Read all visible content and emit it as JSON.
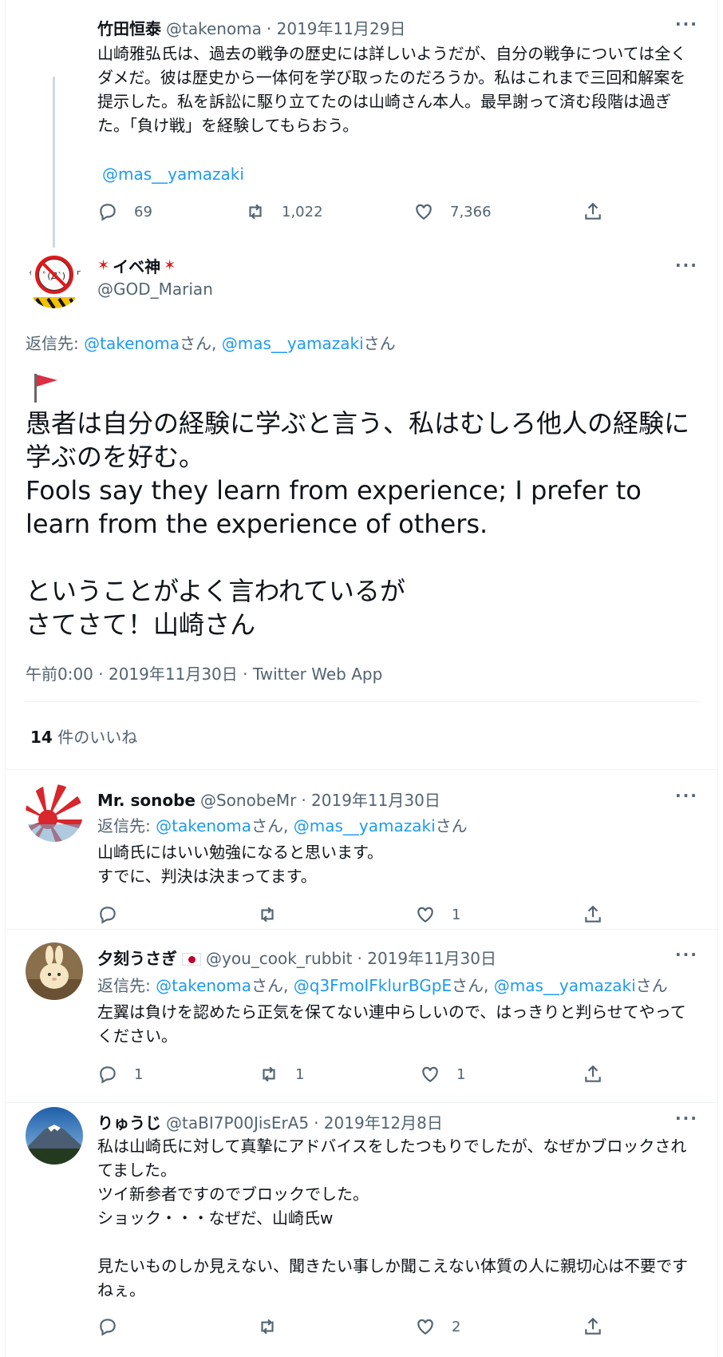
{
  "parent_tweet": {
    "name": "竹田恒泰",
    "handle": "@takenoma",
    "date": "· 2019年11月29日",
    "text": "山崎雅弘氏は、過去の戦争の歴史には詳しいようだが、自分の戦争については全くダメだ。彼は歴史から一体何を学び取ったのだろうか。私はこれまで三回和解案を提示した。私を訴訟に駆り立てたのは山崎さん本人。最早謝って済む段階は過ぎた。「負け戦」を経験してもらおう。",
    "mention": "@mas__yamazaki",
    "replies": "69",
    "retweets": "1,022",
    "likes": "7,366"
  },
  "main_tweet": {
    "name": "イベ神",
    "handle": "@GOD_Marian",
    "reply_label": "返信先: ",
    "reply_to_1": "@takenoma",
    "san": "さん",
    "sep": ", ",
    "reply_to_2": "@mas__yamazaki",
    "text": "愚者は自分の経験に学ぶと言う、私はむしろ他人の経験に学ぶのを好む。\nFools say they learn from experience; I prefer to learn from the experience of others.\n\nということがよく言われているが\nさてさて！山崎さん",
    "timestamp": "午前0:00 · 2019年11月30日 · Twitter Web App",
    "likes_count": "14",
    "likes_label": "件のいいね"
  },
  "replies": [
    {
      "name": "Mr. sonobe",
      "handle": "@SonobeMr",
      "date": "· 2019年11月30日",
      "reply_label": "返信先: ",
      "reply_to": [
        "@takenoma",
        "@mas__yamazaki"
      ],
      "san": "さん",
      "text": "山崎氏にはいい勉強になると思います。\nすでに、判決は決まってます。",
      "replies": "",
      "retweets": "",
      "likes": "1"
    },
    {
      "name": "夕刻うさぎ",
      "handle": "@you_cook_rubbit",
      "date": "· 2019年11月30日",
      "reply_label": "返信先: ",
      "reply_to": [
        "@takenoma",
        "@q3FmoIFklurBGpE",
        "@mas__yamazaki"
      ],
      "san": "さん",
      "text": "左翼は負けを認めたら正気を保てない連中らしいので、はっきりと判らせてやってください。",
      "replies": "1",
      "retweets": "1",
      "likes": "1"
    },
    {
      "name": "りゅうじ",
      "handle": "@taBI7P00JisErA5",
      "date": "· 2019年12月8日",
      "text": "私は山崎氏に対して真摯にアドバイスをしたつもりでしたが、なぜかブロックされてました。\nツイ新参者ですのでブロックでした。\nショック・・・なぜだ、山崎氏w\n\n見たいものしか見えない、聞きたい事しか聞こえない体質の人に親切心は不要ですねぇ。",
      "replies": "",
      "retweets": "",
      "likes": "2"
    }
  ],
  "more_label": "···",
  "colors": {
    "link": "#1d9bf0",
    "muted": "#536471",
    "text": "#0f1419",
    "divider": "#eff3f4"
  }
}
